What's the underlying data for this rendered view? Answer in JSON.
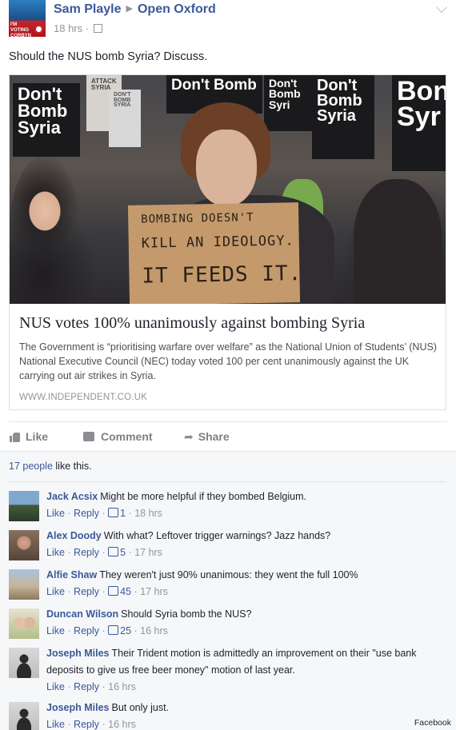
{
  "post": {
    "poster": "Sam Playle",
    "arrow": "▶",
    "page": "Open Oxford",
    "time": "18 hrs",
    "separator": "·",
    "avatar_text": "I'M VOTING CORBYN",
    "status": "Should the NUS bomb Syria? Discuss."
  },
  "photo": {
    "signs": {
      "left": "Don't Bomb Syria",
      "right": "Bon Syr",
      "mid1": "Don't Bomb",
      "mid2": "Don't Bomb Syri",
      "mid3": "Don't Bomb Syria",
      "white1": "ATTACK SYRIA",
      "white2": "DON'T BOMB SYRIA"
    },
    "cardboard": [
      "BOMBING DOESN'T",
      "KILL AN IDEOLOGY.",
      "IT FEEDS IT."
    ]
  },
  "link": {
    "title": "NUS votes 100% unanimously against bombing Syria",
    "description": "The Government is “prioritising warfare over welfare” as the National Union of Students’ (NUS) National Executive Council (NEC) today voted 100 per cent unanimously against the UK carrying out air strikes in Syria.",
    "domain": "WWW.INDEPENDENT.CO.UK"
  },
  "actions": {
    "like": "Like",
    "comment": "Comment",
    "share": "Share"
  },
  "likes": {
    "count": "17 people",
    "suffix": " like this."
  },
  "comments": [
    {
      "name": "Jack Acsix",
      "text": "Might be more helpful if they bombed Belgium.",
      "like": "Like",
      "reply": "Reply",
      "likes": "1",
      "time": "18 hrs"
    },
    {
      "name": "Alex Doody",
      "text": "With what? Leftover trigger warnings? Jazz hands?",
      "like": "Like",
      "reply": "Reply",
      "likes": "5",
      "time": "17 hrs"
    },
    {
      "name": "Alfie Shaw",
      "text": "They weren't just 90% unanimous: they went the full 100%",
      "like": "Like",
      "reply": "Reply",
      "likes": "45",
      "time": "17 hrs"
    },
    {
      "name": "Duncan Wilson",
      "text": "Should Syria bomb the NUS?",
      "like": "Like",
      "reply": "Reply",
      "likes": "25",
      "time": "16 hrs"
    },
    {
      "name": "Joseph Miles",
      "text": "Their Trident motion is admittedly an improvement on their \"use bank deposits to give us free beer money\" motion of last year.",
      "like": "Like",
      "reply": "Reply",
      "time": "16 hrs"
    },
    {
      "name": "Joseph Miles",
      "text": "But only just.",
      "like": "Like",
      "reply": "Reply",
      "time": "16 hrs"
    }
  ],
  "credit": "Facebook"
}
